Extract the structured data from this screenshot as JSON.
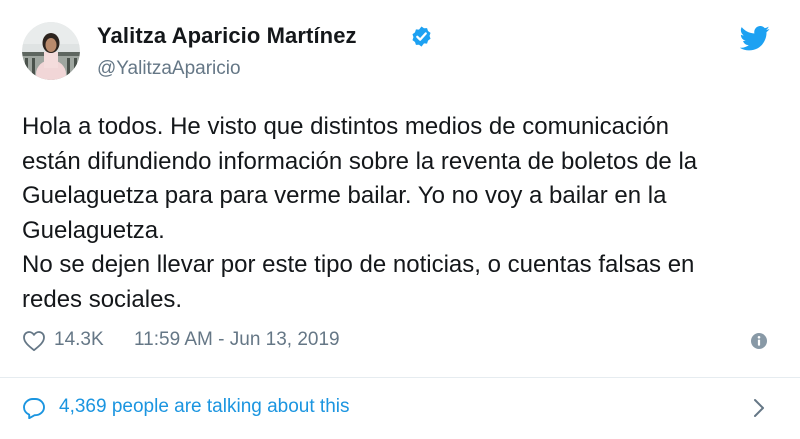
{
  "author": {
    "display_name": "Yalitza Aparicio Martínez",
    "handle": "@YalitzaAparicio",
    "verified": true
  },
  "tweet": {
    "text": "Hola a todos. He visto que distintos medios de comunicación\nestán difundiendo información sobre la reventa de boletos de la\nGuelaguetza para  para verme bailar. Yo no voy a bailar en la\nGuelaguetza.\nNo se dejen llevar por este tipo de noticias, o cuentas falsas en\nredes sociales."
  },
  "meta": {
    "like_count": "14.3K",
    "timestamp": "11:59 AM - Jun 13, 2019"
  },
  "conversation": {
    "label": "4,369 people are talking about this"
  },
  "icons": {
    "brand": "twitter-bird-icon",
    "verified": "verified-badge-icon",
    "like": "heart-outline-icon",
    "info": "info-icon",
    "reply": "speech-bubble-icon",
    "chevron": "chevron-right-icon"
  },
  "colors": {
    "text": "#14171a",
    "secondary": "#657786",
    "accent": "#1da1f2",
    "link": "#1b95e0",
    "divider": "#e6ecf0"
  }
}
